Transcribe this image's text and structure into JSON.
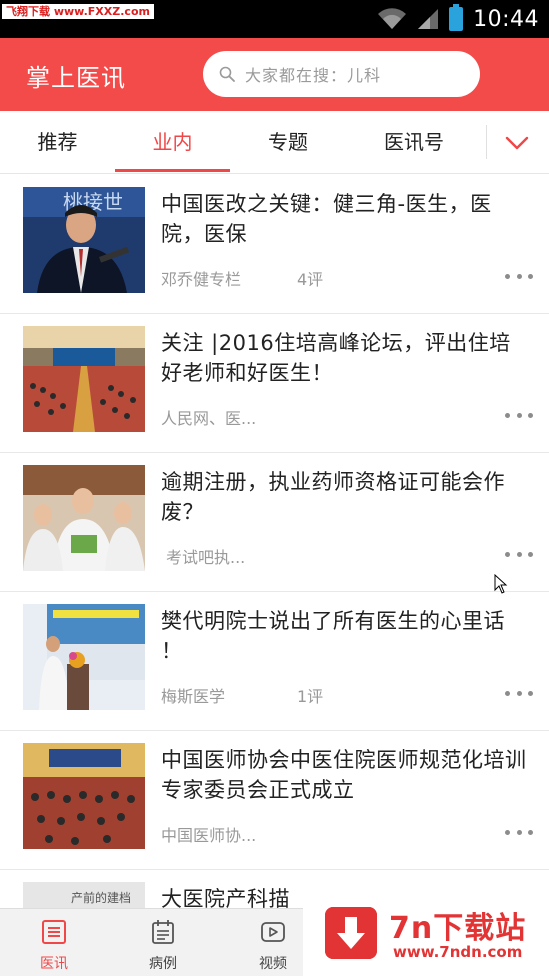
{
  "status_bar": {
    "watermark": "飞翔下载 www.FXXZ.com",
    "time": "10:44"
  },
  "header": {
    "title": "掌上医讯",
    "search_placeholder": "大家都在搜：儿科"
  },
  "tabs": [
    {
      "label": "推荐"
    },
    {
      "label": "业内"
    },
    {
      "label": "专题"
    },
    {
      "label": "医讯号"
    }
  ],
  "active_tab": "业内",
  "articles": [
    {
      "title": "中国医改之关键：健三角-医生，医院，医保",
      "source": "邓乔健专栏",
      "comments": "4评",
      "thumb_text": "桃接世"
    },
    {
      "title": "关注 |2016住培高峰论坛，评出住培好老师和好医生！",
      "source": "人民网、医...",
      "comments": ""
    },
    {
      "title": "逾期注册，执业药师资格证可能会作废？",
      "source": "考试吧执...",
      "comments": ""
    },
    {
      "title": "樊代明院士说出了所有医生的心里话 ！",
      "source": "梅斯医学",
      "comments": "1评"
    },
    {
      "title": "中国医师协会中医住院医师规范化培训专家委员会正式成立",
      "source": "中国医师协...",
      "comments": ""
    },
    {
      "title": "大医院产科描",
      "source": "",
      "comments": "",
      "thumb_text": "产前的建档"
    }
  ],
  "bottom_nav": [
    {
      "label": "医讯",
      "icon": "news-list-icon"
    },
    {
      "label": "病例",
      "icon": "calendar-icon"
    },
    {
      "label": "视频",
      "icon": "play-icon"
    }
  ],
  "active_nav": "医讯",
  "watermark_bottom": {
    "brand": "7n下载站",
    "url": "www.7ndn.com"
  },
  "colors": {
    "primary": "#f34a4a",
    "accent_text": "#f04848",
    "status_bar": "#000000",
    "battery": "#2aa2dc",
    "muted_text": "#999999"
  }
}
